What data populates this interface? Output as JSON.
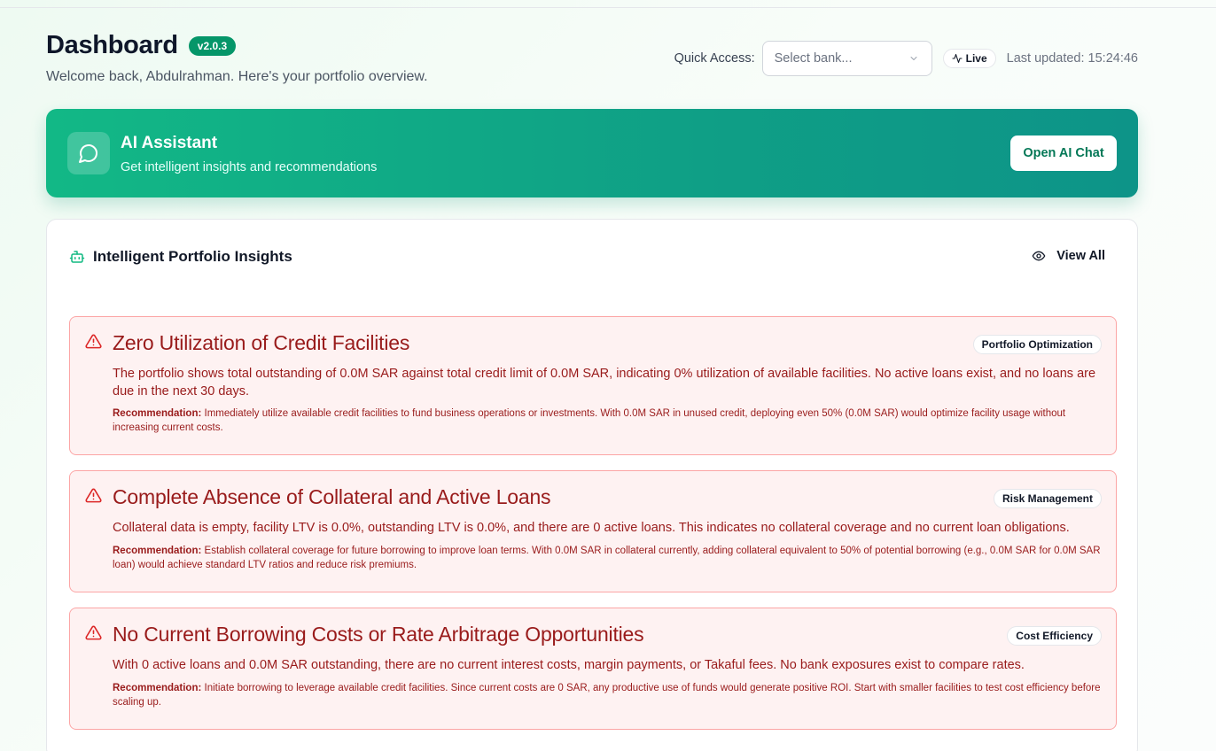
{
  "header": {
    "title": "Dashboard",
    "version": "v2.0.3",
    "subtitle": "Welcome back, Abdulrahman. Here's your portfolio overview.",
    "quick_access_label": "Quick Access:",
    "bank_select_placeholder": "Select bank...",
    "live_label": "Live",
    "last_updated": "Last updated: 15:24:46"
  },
  "ai_assistant": {
    "title": "AI Assistant",
    "subtitle": "Get intelligent insights and recommendations",
    "button_label": "Open AI Chat",
    "icon": "message-circle-icon"
  },
  "insights_panel": {
    "title": "Intelligent Portfolio Insights",
    "view_all_label": "View All",
    "items": [
      {
        "title": "Zero Utilization of Credit Facilities",
        "tag": "Portfolio Optimization",
        "description": "The portfolio shows total outstanding of 0.0M SAR against total credit limit of 0.0M SAR, indicating 0% utilization of available facilities. No active loans exist, and no loans are due in the next 30 days.",
        "recommendation_label": "Recommendation:",
        "recommendation": "Immediately utilize available credit facilities to fund business operations or investments. With 0.0M SAR in unused credit, deploying even 50% (0.0M SAR) would optimize facility usage without increasing current costs."
      },
      {
        "title": "Complete Absence of Collateral and Active Loans",
        "tag": "Risk Management",
        "description": "Collateral data is empty, facility LTV is 0.0%, outstanding LTV is 0.0%, and there are 0 active loans. This indicates no collateral coverage and no current loan obligations.",
        "recommendation_label": "Recommendation:",
        "recommendation": "Establish collateral coverage for future borrowing to improve loan terms. With 0.0M SAR in collateral currently, adding collateral equivalent to 50% of potential borrowing (e.g., 0.0M SAR for 0.0M SAR loan) would achieve standard LTV ratios and reduce risk premiums."
      },
      {
        "title": "No Current Borrowing Costs or Rate Arbitrage Opportunities",
        "tag": "Cost Efficiency",
        "description": "With 0 active loans and 0.0M SAR outstanding, there are no current interest costs, margin payments, or Takaful fees. No bank exposures exist to compare rates.",
        "recommendation_label": "Recommendation:",
        "recommendation": "Initiate borrowing to leverage available credit facilities. Since current costs are 0 SAR, any productive use of funds would generate positive ROI. Start with smaller facilities to test cost efficiency before scaling up."
      }
    ]
  },
  "colors": {
    "brand_green": "#059669",
    "banner_start": "#12b886",
    "banner_end": "#0d9488",
    "alert_bg": "#fef2f2",
    "alert_border": "#fca5a5",
    "alert_text": "#991b1b"
  }
}
